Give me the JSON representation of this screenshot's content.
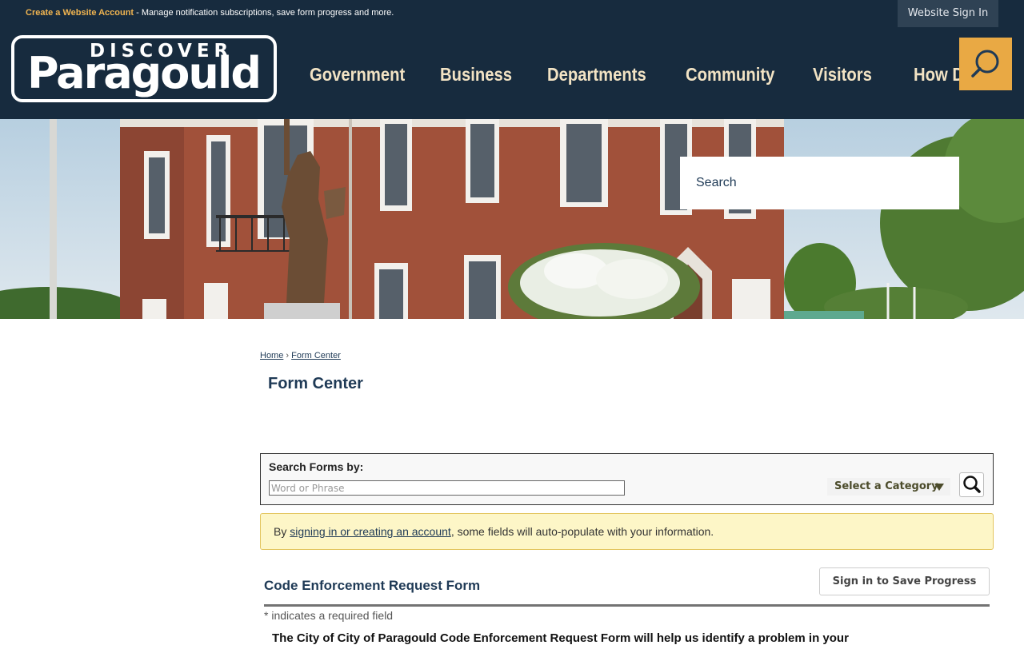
{
  "topbar": {
    "create_account_link": "Create a Website Account",
    "create_account_desc": " - Manage notification subscriptions, save form progress and more.",
    "sign_in": "Website Sign In"
  },
  "logo": {
    "top_text": "DISCOVER",
    "name": "Paragould"
  },
  "nav": [
    "Government",
    "Business",
    "Departments",
    "Community",
    "Visitors",
    "How Do I..."
  ],
  "hero_search": {
    "placeholder": "Search"
  },
  "breadcrumb": {
    "home": "Home",
    "separator": "›",
    "current": "Form Center"
  },
  "page_title": "Form Center",
  "form_search": {
    "label": "Search Forms by:",
    "placeholder": "Word or Phrase",
    "category": "Select a Category"
  },
  "alert": {
    "prefix": "By ",
    "link": "signing in or creating an account",
    "suffix": ", some fields will auto-populate with your information."
  },
  "form": {
    "title": "Code Enforcement Request Form",
    "save_button": "Sign in to Save Progress",
    "required_note": "* indicates a required field",
    "intro": "The City of City of Paragould Code Enforcement Request Form will help us identify a problem in your"
  },
  "colors": {
    "header": "#172b3e",
    "accent": "#e9a944",
    "nav_text": "#f2e3c4",
    "alert_bg": "#fdf6c7"
  }
}
